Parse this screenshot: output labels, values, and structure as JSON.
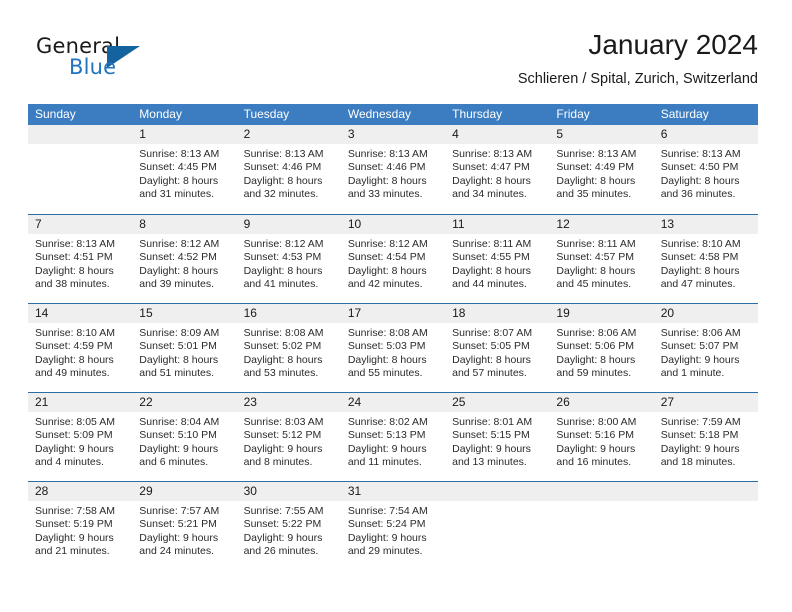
{
  "brand": {
    "name_part1": "General",
    "name_part2": "Blue",
    "accent_color": "#1f74bd",
    "triangle_color": "#14639f"
  },
  "header": {
    "title": "January 2024",
    "location": "Schlieren / Spital, Zurich, Switzerland"
  },
  "calendar": {
    "header_bg": "#3b7dc0",
    "daynum_band_bg": "#efefef",
    "week_separator_color": "#2f6da8",
    "weekdays": [
      "Sunday",
      "Monday",
      "Tuesday",
      "Wednesday",
      "Thursday",
      "Friday",
      "Saturday"
    ],
    "weeks": [
      [
        {
          "empty": true
        },
        {
          "day": "1",
          "sunrise": "Sunrise: 8:13 AM",
          "sunset": "Sunset: 4:45 PM",
          "daylight_line1": "Daylight: 8 hours",
          "daylight_line2": "and 31 minutes."
        },
        {
          "day": "2",
          "sunrise": "Sunrise: 8:13 AM",
          "sunset": "Sunset: 4:46 PM",
          "daylight_line1": "Daylight: 8 hours",
          "daylight_line2": "and 32 minutes."
        },
        {
          "day": "3",
          "sunrise": "Sunrise: 8:13 AM",
          "sunset": "Sunset: 4:46 PM",
          "daylight_line1": "Daylight: 8 hours",
          "daylight_line2": "and 33 minutes."
        },
        {
          "day": "4",
          "sunrise": "Sunrise: 8:13 AM",
          "sunset": "Sunset: 4:47 PM",
          "daylight_line1": "Daylight: 8 hours",
          "daylight_line2": "and 34 minutes."
        },
        {
          "day": "5",
          "sunrise": "Sunrise: 8:13 AM",
          "sunset": "Sunset: 4:49 PM",
          "daylight_line1": "Daylight: 8 hours",
          "daylight_line2": "and 35 minutes."
        },
        {
          "day": "6",
          "sunrise": "Sunrise: 8:13 AM",
          "sunset": "Sunset: 4:50 PM",
          "daylight_line1": "Daylight: 8 hours",
          "daylight_line2": "and 36 minutes."
        }
      ],
      [
        {
          "day": "7",
          "sunrise": "Sunrise: 8:13 AM",
          "sunset": "Sunset: 4:51 PM",
          "daylight_line1": "Daylight: 8 hours",
          "daylight_line2": "and 38 minutes."
        },
        {
          "day": "8",
          "sunrise": "Sunrise: 8:12 AM",
          "sunset": "Sunset: 4:52 PM",
          "daylight_line1": "Daylight: 8 hours",
          "daylight_line2": "and 39 minutes."
        },
        {
          "day": "9",
          "sunrise": "Sunrise: 8:12 AM",
          "sunset": "Sunset: 4:53 PM",
          "daylight_line1": "Daylight: 8 hours",
          "daylight_line2": "and 41 minutes."
        },
        {
          "day": "10",
          "sunrise": "Sunrise: 8:12 AM",
          "sunset": "Sunset: 4:54 PM",
          "daylight_line1": "Daylight: 8 hours",
          "daylight_line2": "and 42 minutes."
        },
        {
          "day": "11",
          "sunrise": "Sunrise: 8:11 AM",
          "sunset": "Sunset: 4:55 PM",
          "daylight_line1": "Daylight: 8 hours",
          "daylight_line2": "and 44 minutes."
        },
        {
          "day": "12",
          "sunrise": "Sunrise: 8:11 AM",
          "sunset": "Sunset: 4:57 PM",
          "daylight_line1": "Daylight: 8 hours",
          "daylight_line2": "and 45 minutes."
        },
        {
          "day": "13",
          "sunrise": "Sunrise: 8:10 AM",
          "sunset": "Sunset: 4:58 PM",
          "daylight_line1": "Daylight: 8 hours",
          "daylight_line2": "and 47 minutes."
        }
      ],
      [
        {
          "day": "14",
          "sunrise": "Sunrise: 8:10 AM",
          "sunset": "Sunset: 4:59 PM",
          "daylight_line1": "Daylight: 8 hours",
          "daylight_line2": "and 49 minutes."
        },
        {
          "day": "15",
          "sunrise": "Sunrise: 8:09 AM",
          "sunset": "Sunset: 5:01 PM",
          "daylight_line1": "Daylight: 8 hours",
          "daylight_line2": "and 51 minutes."
        },
        {
          "day": "16",
          "sunrise": "Sunrise: 8:08 AM",
          "sunset": "Sunset: 5:02 PM",
          "daylight_line1": "Daylight: 8 hours",
          "daylight_line2": "and 53 minutes."
        },
        {
          "day": "17",
          "sunrise": "Sunrise: 8:08 AM",
          "sunset": "Sunset: 5:03 PM",
          "daylight_line1": "Daylight: 8 hours",
          "daylight_line2": "and 55 minutes."
        },
        {
          "day": "18",
          "sunrise": "Sunrise: 8:07 AM",
          "sunset": "Sunset: 5:05 PM",
          "daylight_line1": "Daylight: 8 hours",
          "daylight_line2": "and 57 minutes."
        },
        {
          "day": "19",
          "sunrise": "Sunrise: 8:06 AM",
          "sunset": "Sunset: 5:06 PM",
          "daylight_line1": "Daylight: 8 hours",
          "daylight_line2": "and 59 minutes."
        },
        {
          "day": "20",
          "sunrise": "Sunrise: 8:06 AM",
          "sunset": "Sunset: 5:07 PM",
          "daylight_line1": "Daylight: 9 hours",
          "daylight_line2": "and 1 minute."
        }
      ],
      [
        {
          "day": "21",
          "sunrise": "Sunrise: 8:05 AM",
          "sunset": "Sunset: 5:09 PM",
          "daylight_line1": "Daylight: 9 hours",
          "daylight_line2": "and 4 minutes."
        },
        {
          "day": "22",
          "sunrise": "Sunrise: 8:04 AM",
          "sunset": "Sunset: 5:10 PM",
          "daylight_line1": "Daylight: 9 hours",
          "daylight_line2": "and 6 minutes."
        },
        {
          "day": "23",
          "sunrise": "Sunrise: 8:03 AM",
          "sunset": "Sunset: 5:12 PM",
          "daylight_line1": "Daylight: 9 hours",
          "daylight_line2": "and 8 minutes."
        },
        {
          "day": "24",
          "sunrise": "Sunrise: 8:02 AM",
          "sunset": "Sunset: 5:13 PM",
          "daylight_line1": "Daylight: 9 hours",
          "daylight_line2": "and 11 minutes."
        },
        {
          "day": "25",
          "sunrise": "Sunrise: 8:01 AM",
          "sunset": "Sunset: 5:15 PM",
          "daylight_line1": "Daylight: 9 hours",
          "daylight_line2": "and 13 minutes."
        },
        {
          "day": "26",
          "sunrise": "Sunrise: 8:00 AM",
          "sunset": "Sunset: 5:16 PM",
          "daylight_line1": "Daylight: 9 hours",
          "daylight_line2": "and 16 minutes."
        },
        {
          "day": "27",
          "sunrise": "Sunrise: 7:59 AM",
          "sunset": "Sunset: 5:18 PM",
          "daylight_line1": "Daylight: 9 hours",
          "daylight_line2": "and 18 minutes."
        }
      ],
      [
        {
          "day": "28",
          "sunrise": "Sunrise: 7:58 AM",
          "sunset": "Sunset: 5:19 PM",
          "daylight_line1": "Daylight: 9 hours",
          "daylight_line2": "and 21 minutes."
        },
        {
          "day": "29",
          "sunrise": "Sunrise: 7:57 AM",
          "sunset": "Sunset: 5:21 PM",
          "daylight_line1": "Daylight: 9 hours",
          "daylight_line2": "and 24 minutes."
        },
        {
          "day": "30",
          "sunrise": "Sunrise: 7:55 AM",
          "sunset": "Sunset: 5:22 PM",
          "daylight_line1": "Daylight: 9 hours",
          "daylight_line2": "and 26 minutes."
        },
        {
          "day": "31",
          "sunrise": "Sunrise: 7:54 AM",
          "sunset": "Sunset: 5:24 PM",
          "daylight_line1": "Daylight: 9 hours",
          "daylight_line2": "and 29 minutes."
        },
        {
          "empty": true
        },
        {
          "empty": true
        },
        {
          "empty": true
        }
      ]
    ]
  }
}
